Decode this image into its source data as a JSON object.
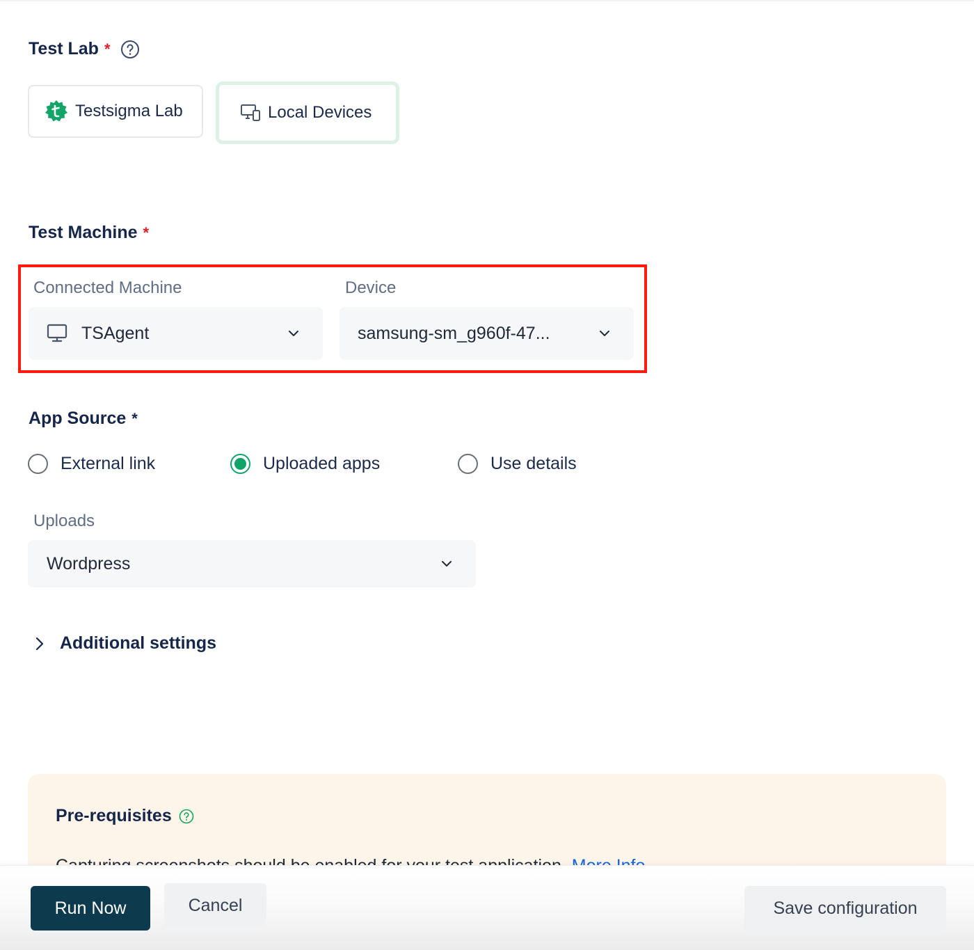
{
  "test_lab": {
    "title": "Test Lab",
    "required_mark": "*",
    "help_icon": "question-circle-icon",
    "options": [
      {
        "label": "Testsigma Lab",
        "icon": "testsigma-logo-icon",
        "selected": false
      },
      {
        "label": "Local Devices",
        "icon": "desktop-mobile-icon",
        "selected": true
      }
    ]
  },
  "test_machine": {
    "title": "Test Machine",
    "required_mark": "*",
    "connected_machine": {
      "label": "Connected Machine",
      "value": "TSAgent",
      "icon": "monitor-icon"
    },
    "device": {
      "label": "Device",
      "value": "samsung-sm_g960f-47..."
    }
  },
  "app_source": {
    "title": "App Source",
    "required_mark": "*",
    "options": [
      {
        "label": "External link",
        "checked": false
      },
      {
        "label": "Uploaded apps",
        "checked": true
      },
      {
        "label": "Use details",
        "checked": false
      }
    ],
    "uploads": {
      "label": "Uploads",
      "value": "Wordpress"
    }
  },
  "additional_settings": {
    "label": "Additional settings",
    "expanded": false
  },
  "prerequisites": {
    "title": "Pre-requisites",
    "text": "Capturing screenshots should be enabled for your test application.",
    "link": "More Info"
  },
  "footer": {
    "run_label": "Run Now",
    "cancel_label": "Cancel",
    "save_label": "Save configuration"
  },
  "colors": {
    "primary": "#0d3b4d",
    "accent_green": "#10a46b",
    "required_red": "#e11d2a",
    "highlight_frame": "#ff1a0f",
    "link_blue": "#1565d8",
    "prereq_bg": "#fdf5e9"
  }
}
